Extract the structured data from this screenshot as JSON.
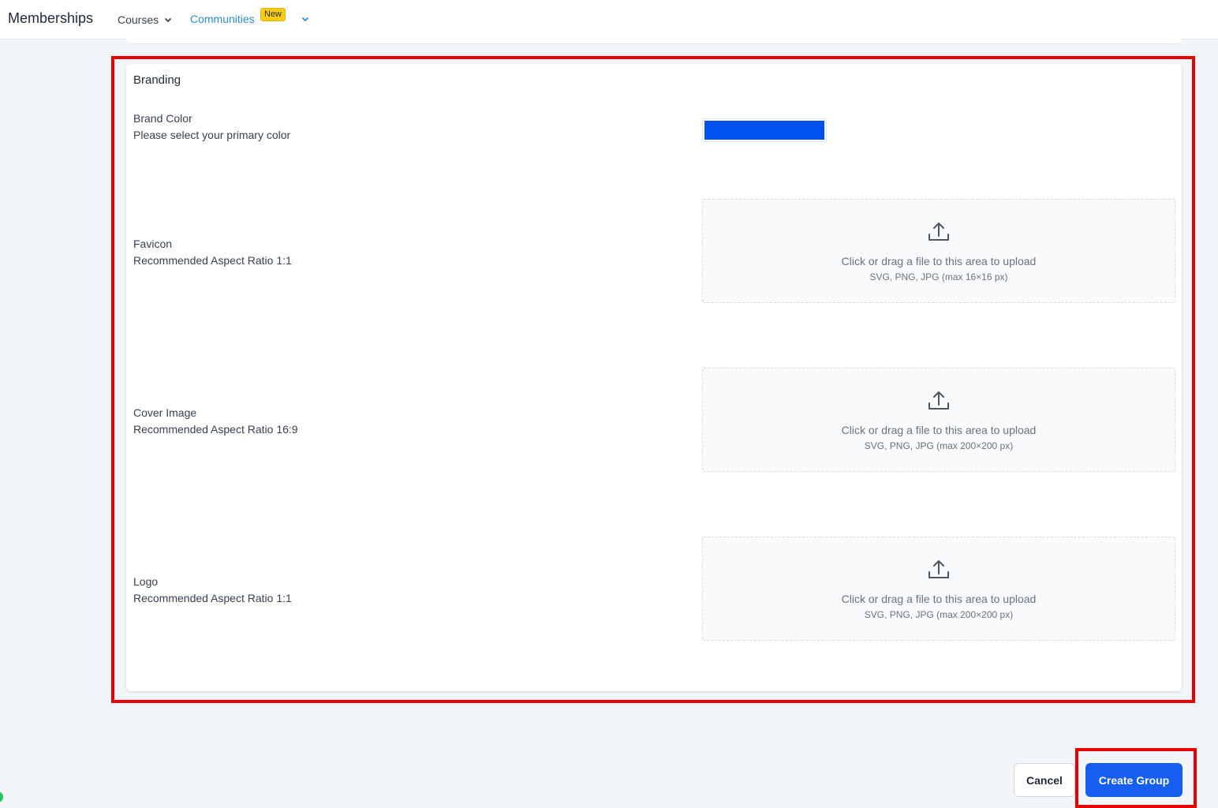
{
  "header": {
    "app_title": "Memberships",
    "nav": {
      "courses_label": "Courses",
      "communities_label": "Communities",
      "new_badge": "New"
    }
  },
  "branding": {
    "section_title": "Branding",
    "brand_color": {
      "label": "Brand Color",
      "description": "Please select your primary color",
      "value": "#0052ee"
    },
    "favicon": {
      "label": "Favicon",
      "description": "Recommended Aspect Ratio 1:1",
      "upload_text": "Click or drag a file to this area to upload",
      "upload_hint": "SVG, PNG, JPG (max 16×16 px)"
    },
    "cover_image": {
      "label": "Cover Image",
      "description": "Recommended Aspect Ratio 16:9",
      "upload_text": "Click or drag a file to this area to upload",
      "upload_hint": "SVG, PNG, JPG (max 200×200 px)"
    },
    "logo": {
      "label": "Logo",
      "description": "Recommended Aspect Ratio 1:1",
      "upload_text": "Click or drag a file to this area to upload",
      "upload_hint": "SVG, PNG, JPG (max 200×200 px)"
    }
  },
  "footer": {
    "cancel_label": "Cancel",
    "create_label": "Create Group"
  },
  "colors": {
    "accent": "#155eef",
    "highlight": "#e60000",
    "tab_active": "#2e8ccf"
  }
}
